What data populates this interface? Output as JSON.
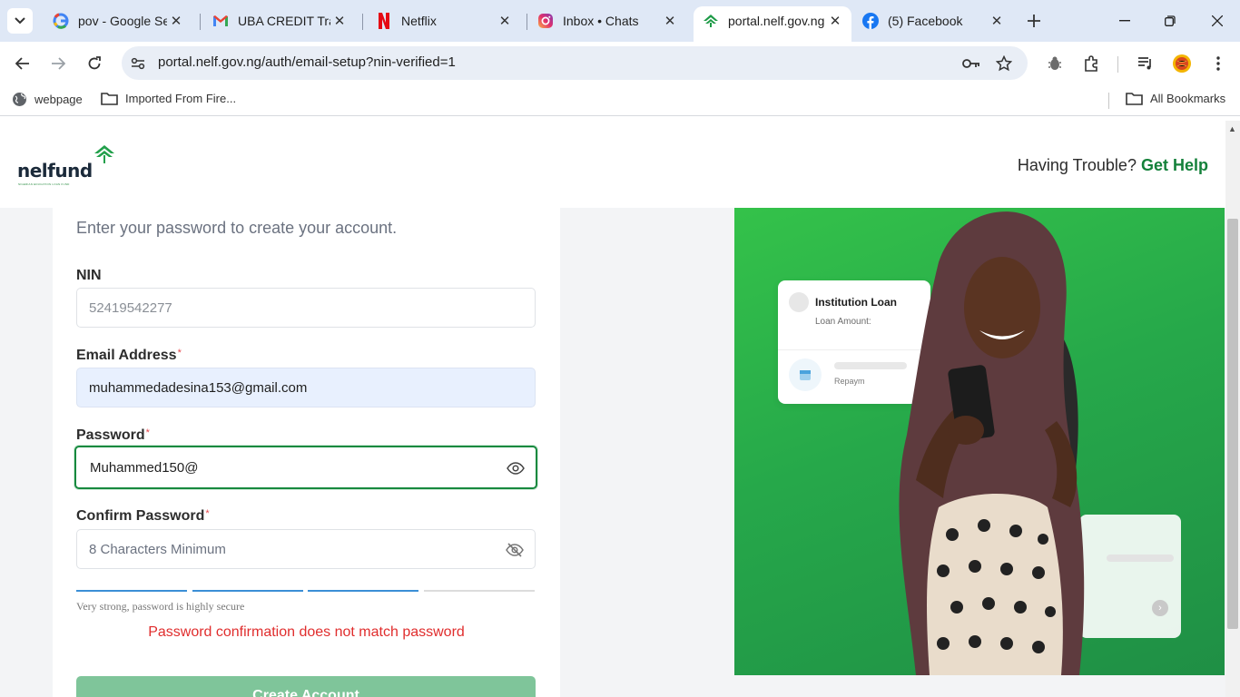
{
  "browser": {
    "tabs": [
      {
        "title": "pov - Google Sea",
        "icon": "google-icon"
      },
      {
        "title": "UBA CREDIT Tran",
        "icon": "gmail-icon"
      },
      {
        "title": "Netflix",
        "icon": "netflix-icon"
      },
      {
        "title": "Inbox • Chats",
        "icon": "instagram-icon"
      },
      {
        "title": "portal.nelf.gov.ng",
        "icon": "nelfund-icon",
        "active": true
      },
      {
        "title": "(5) Facebook",
        "icon": "facebook-icon"
      }
    ],
    "url": "portal.nelf.gov.ng/auth/email-setup?nin-verified=1",
    "bookmarks": [
      {
        "label": "webpage",
        "icon": "globe-icon"
      },
      {
        "label": "Imported From Fire...",
        "icon": "folder-icon"
      }
    ],
    "all_bookmarks": "All Bookmarks"
  },
  "header": {
    "logo_text": "nelfund",
    "logo_subtext": "NIGERIAN EDUCATION LOAN FUND",
    "help_prefix": "Having Trouble?",
    "help_link": "Get Help"
  },
  "form": {
    "subtitle": "Enter your password to create your account.",
    "nin": {
      "label": "NIN",
      "value": "52419542277"
    },
    "email": {
      "label": "Email Address",
      "required": "*",
      "value": "muhammedadesina153@gmail.com"
    },
    "password": {
      "label": "Password",
      "required": "*",
      "value": "Muhammed150@"
    },
    "confirm_password": {
      "label": "Confirm Password",
      "required": "*",
      "placeholder": "8 Characters Minimum",
      "value": ""
    },
    "strength": {
      "filled_segments": 3,
      "total_segments": 4,
      "text": "Very strong, password is highly secure"
    },
    "error": "Password confirmation does not match password",
    "submit_label": "Create Account"
  },
  "hero": {
    "card_title": "Institution Loan",
    "card_amount_label": "Loan Amount:",
    "card_repayment_label": "Repaym"
  },
  "colors": {
    "brand_green": "#14813a",
    "focus_border": "#17893f",
    "error_red": "#e02d2d",
    "strength_blue": "#3b8fd6",
    "button_disabled": "#7fc59a"
  }
}
